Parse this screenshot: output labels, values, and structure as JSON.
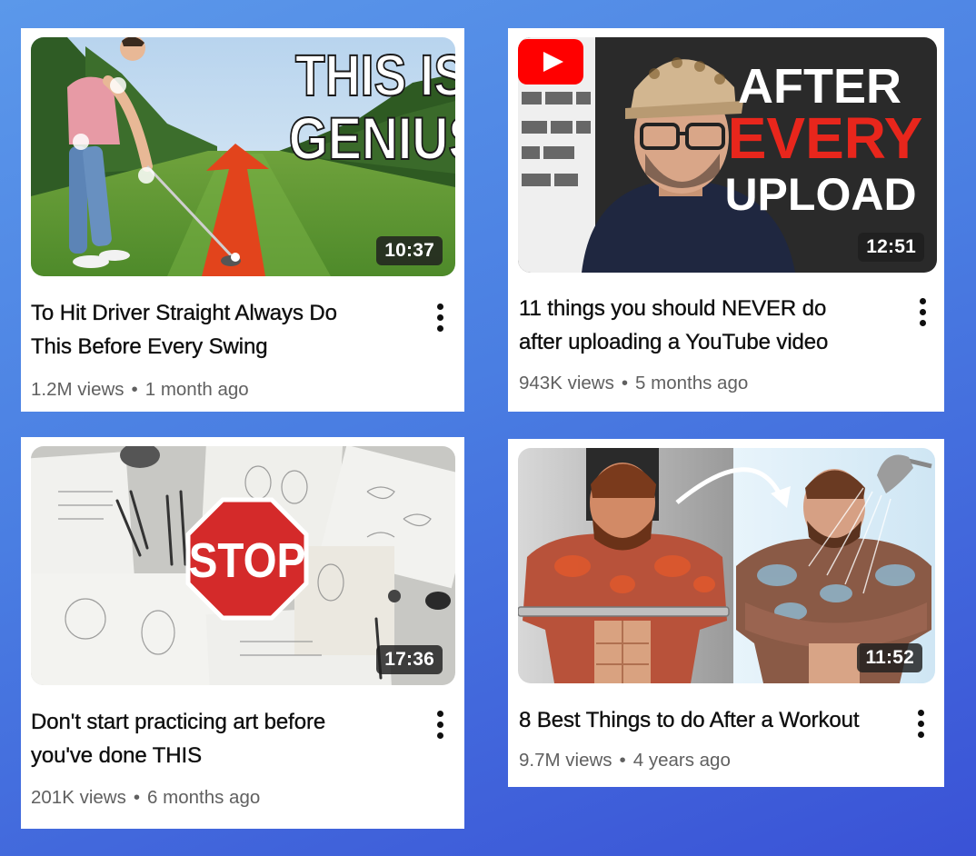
{
  "videos": [
    {
      "title_line1": "To Hit Driver Straight Always Do",
      "title_line2": "This Before Every Swing",
      "views": "1.2M views",
      "separator": "•",
      "age": "1 month ago",
      "duration": "10:37",
      "overlay_line1": "THIS IS",
      "overlay_line2": "GENIUS"
    },
    {
      "title_line1": "11 things you should NEVER do",
      "title_line2": "after uploading a YouTube video",
      "views": "943K views",
      "separator": "•",
      "age": "5 months ago",
      "duration": "12:51",
      "overlay_line1": "AFTER",
      "overlay_line2": "EVERY",
      "overlay_line3": "UPLOAD"
    },
    {
      "title_line1": "Don't start practicing art before",
      "title_line2": "you've done THIS",
      "views": "201K views",
      "separator": "•",
      "age": "6 months ago",
      "duration": "17:36",
      "overlay_line1": "STOP"
    },
    {
      "title_line1": "8 Best Things to do After a Workout",
      "views": "9.7M views",
      "separator": "•",
      "age": "4 years ago",
      "duration": "11:52"
    }
  ],
  "colors": {
    "background_top": "#5b98ea",
    "background_bottom": "#3a52d6",
    "card": "#ffffff",
    "title_text": "#0f0f0f",
    "meta_text": "#606060",
    "youtube_red": "#ff0000",
    "stop_red": "#d42a2a"
  },
  "icons": [
    "more-vert-icon",
    "youtube-logo-icon",
    "arrow-icon",
    "shower-icon"
  ]
}
